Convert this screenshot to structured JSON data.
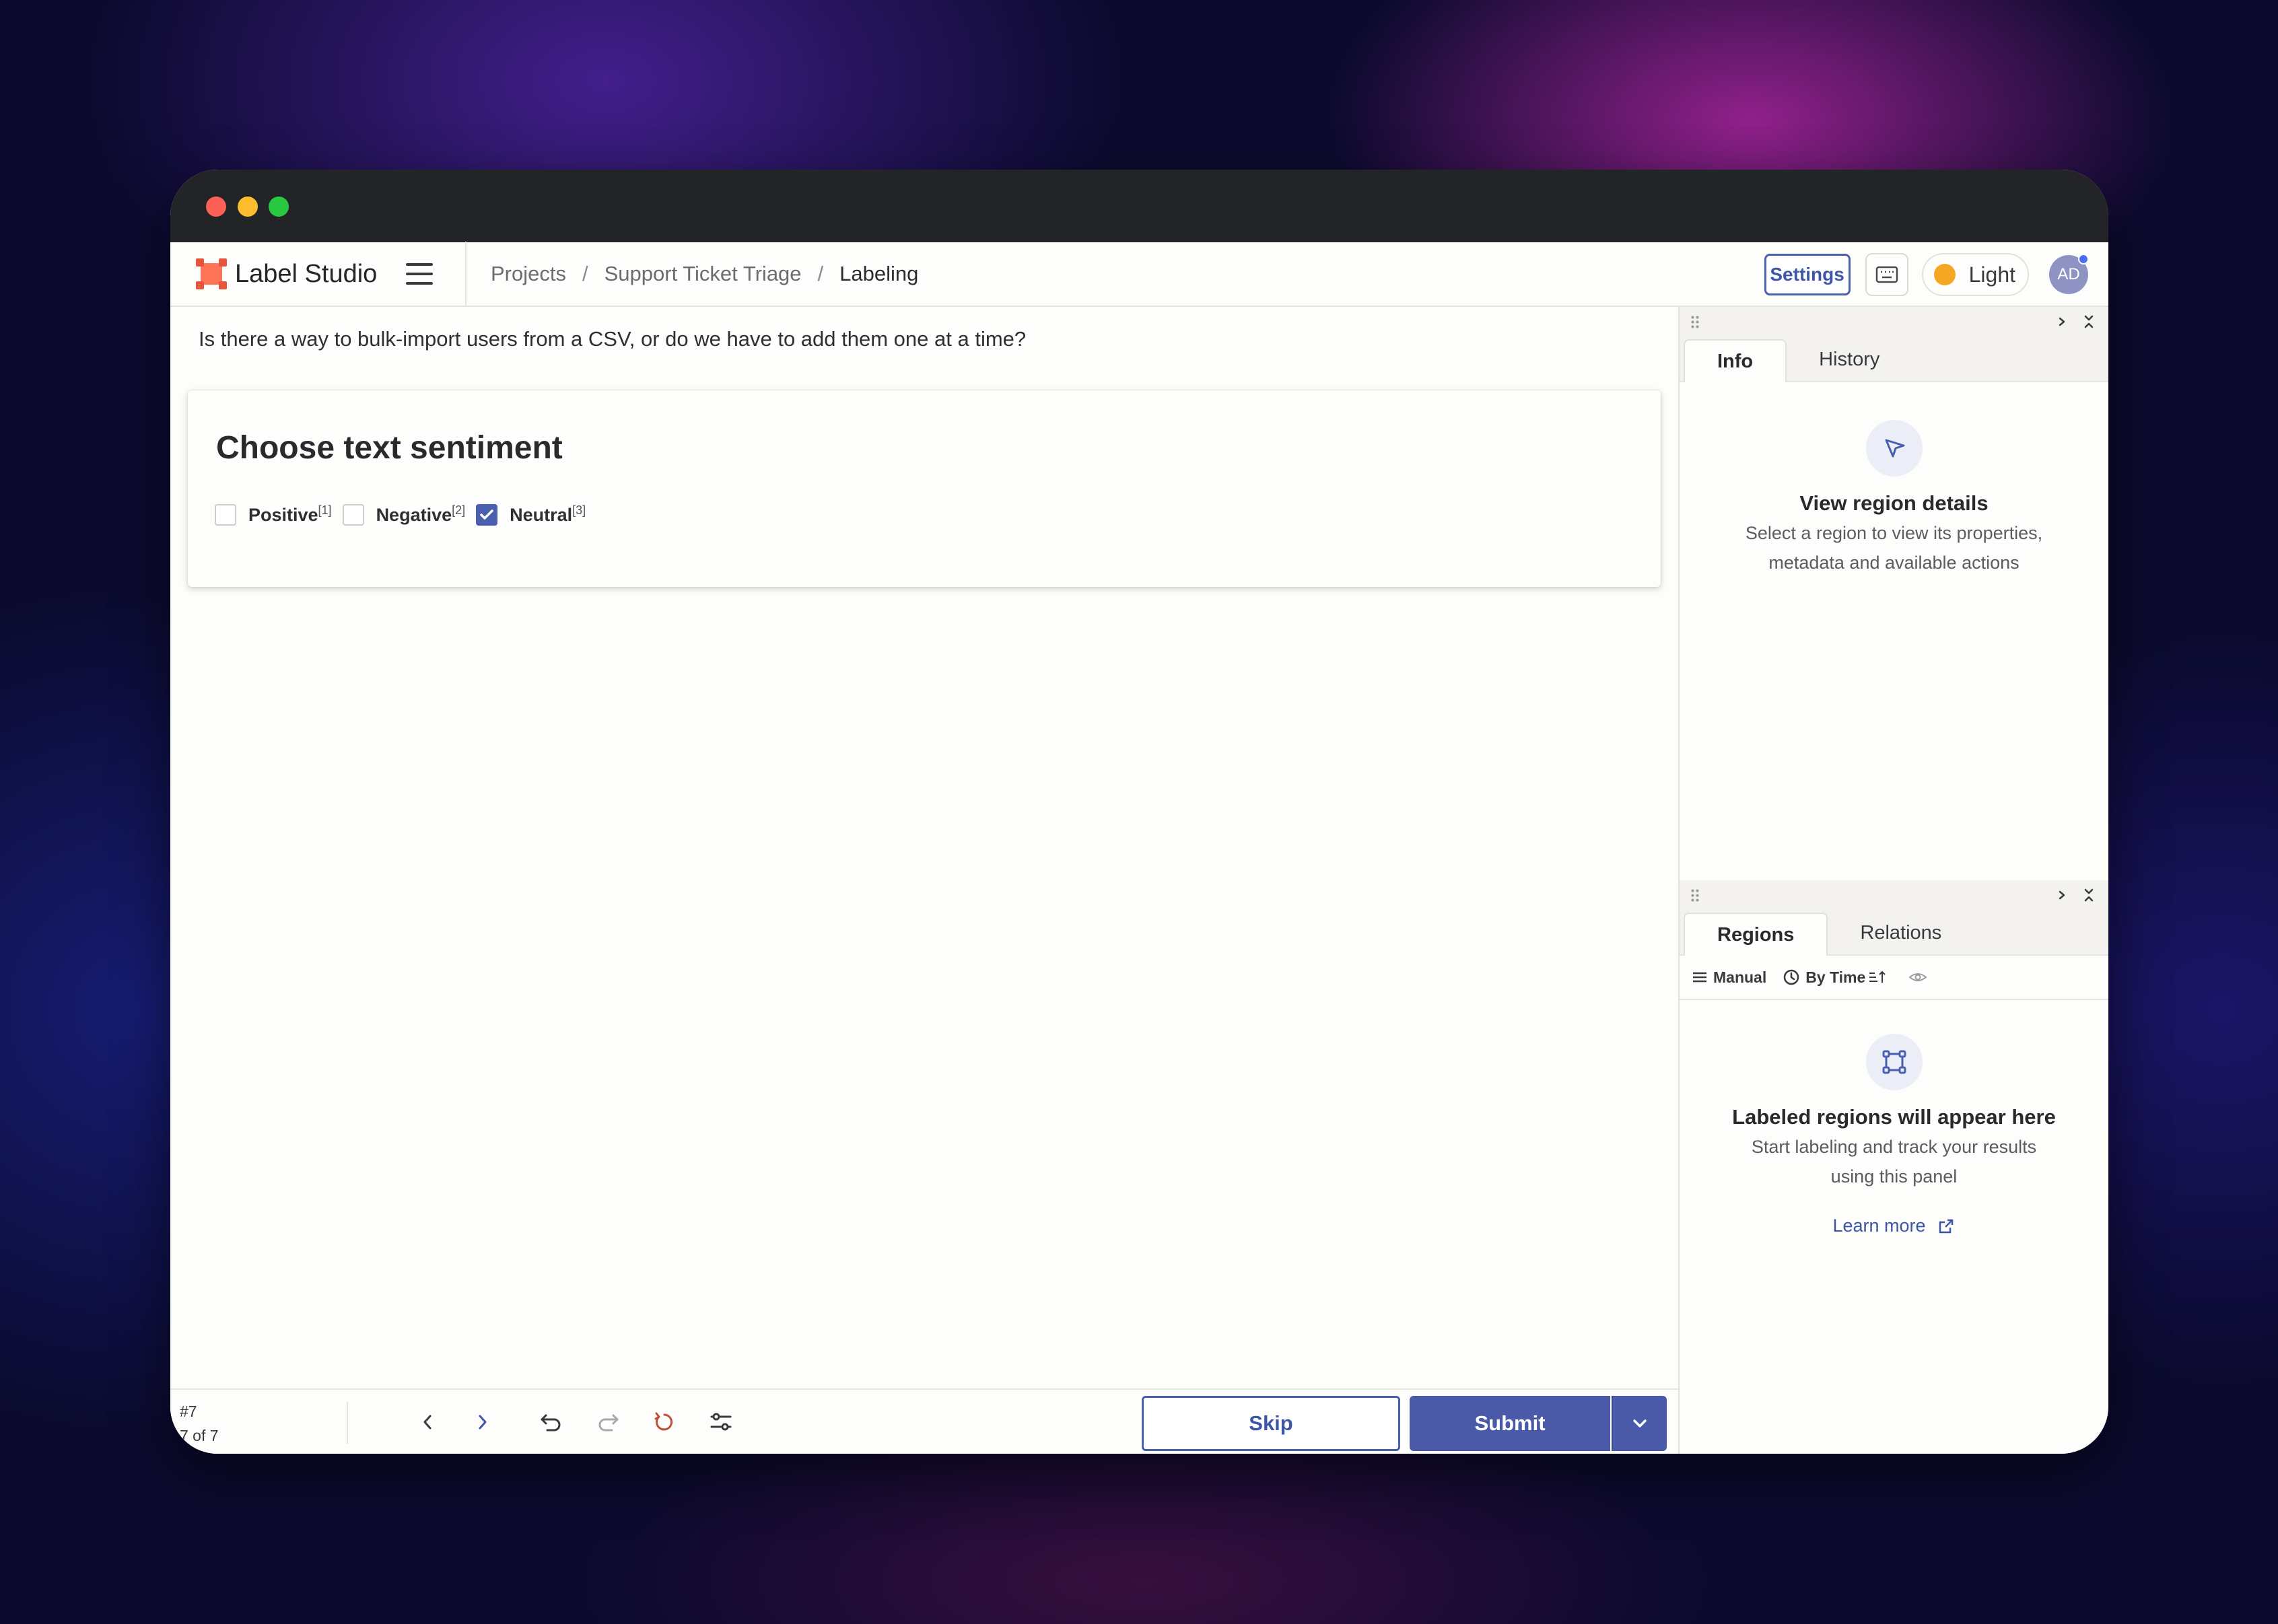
{
  "app": {
    "name": "Label Studio"
  },
  "breadcrumb": {
    "projects": "Projects",
    "project": "Support Ticket Triage",
    "current": "Labeling",
    "separator": "/"
  },
  "nav": {
    "settings_label": "Settings",
    "theme_label": "Light",
    "avatar_initials": "AD"
  },
  "task": {
    "text": "Is there a way to bulk-import users from a CSV, or do we have to add them one at a time?"
  },
  "sentiment": {
    "title": "Choose text sentiment",
    "choices": [
      {
        "label": "Positive",
        "hotkey": "[1]",
        "checked": false
      },
      {
        "label": "Negative",
        "hotkey": "[2]",
        "checked": false
      },
      {
        "label": "Neutral",
        "hotkey": "[3]",
        "checked": true
      }
    ]
  },
  "bottom": {
    "task_id": "#7",
    "position": "7 of 7",
    "skip_label": "Skip",
    "submit_label": "Submit"
  },
  "info_panel": {
    "tabs": [
      "Info",
      "History"
    ],
    "active_tab": "Info",
    "empty_title": "View region details",
    "empty_desc_line1": "Select a region to view its properties,",
    "empty_desc_line2": "metadata and available actions"
  },
  "regions_panel": {
    "tabs": [
      "Regions",
      "Relations"
    ],
    "active_tab": "Regions",
    "filter_manual": "Manual",
    "filter_sort": "By Time",
    "empty_title": "Labeled regions will appear here",
    "empty_desc_line1": "Start labeling and track your results",
    "empty_desc_line2": "using this panel",
    "learn_more": "Learn more"
  },
  "colors": {
    "accent": "#4a5aa8",
    "logo": "#ff7557",
    "sun": "#f5a623",
    "undo_reset": "#c0503a"
  }
}
